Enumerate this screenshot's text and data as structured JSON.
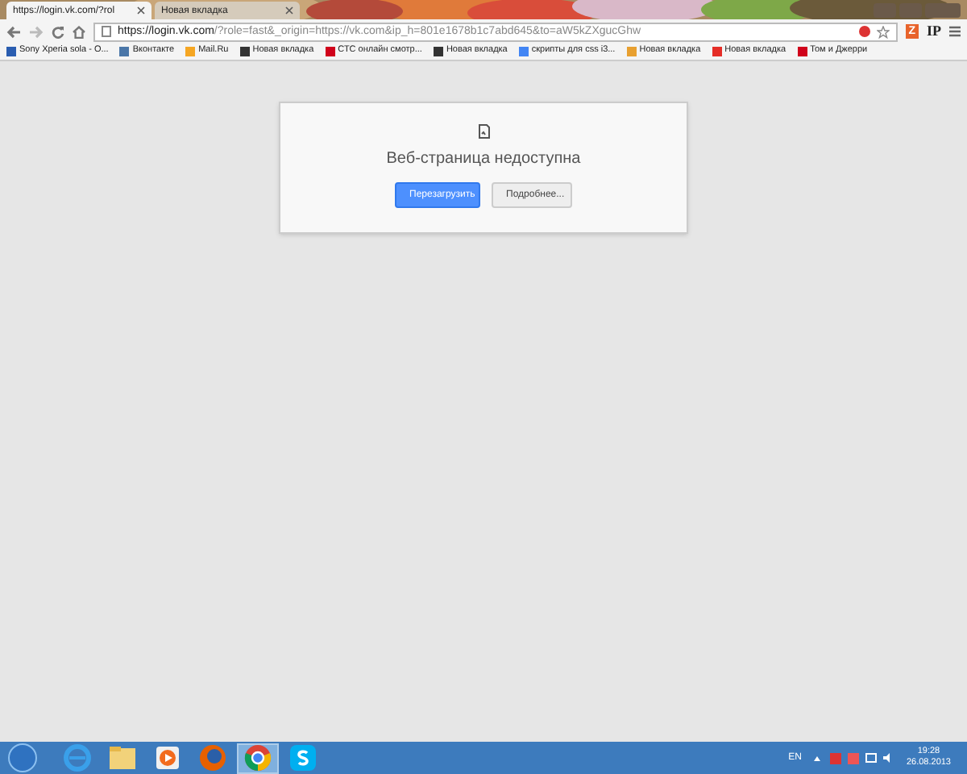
{
  "tabs": [
    {
      "label": "https://login.vk.com/?rol",
      "selected": true
    },
    {
      "label": "Новая вкладка",
      "selected": false
    }
  ],
  "address_bar": {
    "value_host": "https://login.vk.com",
    "value_rest": "/?role=fast&_origin=https://vk.com&ip_h=801e1678b1c7abd645&to=aW5kZXgucGhw"
  },
  "extensions": [
    {
      "kind": "badge",
      "label": "Z"
    },
    {
      "kind": "text",
      "label": "IP"
    }
  ],
  "bookmarks": [
    {
      "label": "Sony Xperia sola - O...",
      "color": "#2a5db0"
    },
    {
      "label": "Вконтакте",
      "color": "#4a76a8"
    },
    {
      "label": "Mail.Ru",
      "color": "#f5a623"
    },
    {
      "label": "Новая вкладка",
      "color": "#333333"
    },
    {
      "label": "СТС онлайн смотр...",
      "color": "#d0021b"
    },
    {
      "label": "Новая вкладка",
      "color": "#333333"
    },
    {
      "label": "скрипты для css i3...",
      "color": "#4285f4"
    },
    {
      "label": "Новая вкладка",
      "color": "#e8a030"
    },
    {
      "label": "Новая вкладка",
      "color": "#e52d27"
    },
    {
      "label": "Том и Джерри",
      "color": "#d0021b"
    }
  ],
  "error_page": {
    "title": "Веб-страница недоступна",
    "buttons": [
      {
        "label": "Перезагрузить",
        "kind": "primary"
      },
      {
        "label": "Подробнее...",
        "kind": "secondary"
      }
    ]
  },
  "taskbar": {
    "apps": [
      {
        "kind": "ie",
        "selected": false
      },
      {
        "kind": "folder",
        "selected": false
      },
      {
        "kind": "media",
        "selected": false
      },
      {
        "kind": "firefox",
        "selected": false
      },
      {
        "kind": "chrome",
        "selected": true
      },
      {
        "kind": "skype",
        "selected": false
      }
    ],
    "language": "EN",
    "time": "19:28",
    "date": "26.08.2013"
  }
}
